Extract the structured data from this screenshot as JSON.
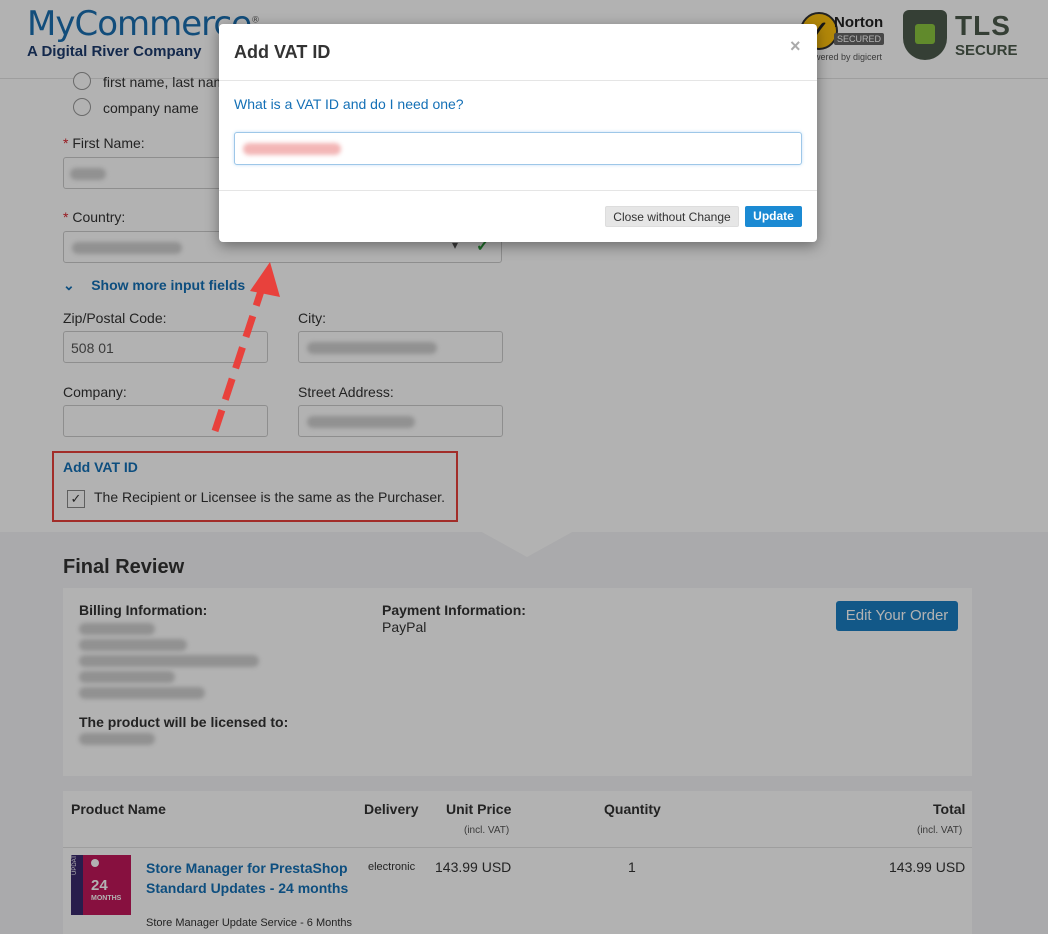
{
  "header": {
    "logo_title": "MyCommerce",
    "logo_reg": "®",
    "logo_subtitle": "A Digital River Company",
    "norton_name": "Norton",
    "norton_secured": "SECURED",
    "norton_powered": "powered by digicert",
    "tls_title": "TLS",
    "tls_sub": "SECURE"
  },
  "form": {
    "radio_name_label": "first name, last name",
    "radio_company_label": "company name",
    "first_name_label": "First Name:",
    "country_label": "Country:",
    "show_more_label": "Show more input fields",
    "zip_label": "Zip/Postal Code:",
    "zip_value": "508 01",
    "city_label": "City:",
    "company_label": "Company:",
    "street_label": "Street Address:",
    "add_vat_label": "Add VAT ID",
    "recipient_label": "The Recipient or Licensee is the same as the Purchaser.",
    "recipient_checked": true,
    "required_mark": "*"
  },
  "review": {
    "title": "Final Review",
    "billing_heading": "Billing Information:",
    "payment_heading": "Payment Information:",
    "payment_value": "PayPal",
    "edit_button": "Edit Your Order",
    "licensed_heading": "The product will be licensed to:"
  },
  "table": {
    "headers": {
      "product": "Product Name",
      "delivery": "Delivery",
      "unit_price": "Unit Price",
      "unit_price_sub": "(incl. VAT)",
      "quantity": "Quantity",
      "total": "Total",
      "total_sub": "(incl. VAT)"
    },
    "rows": [
      {
        "product_name": "Store Manager for PrestaShop Standard Updates - 24 months",
        "product_sub": "Store Manager Update Service - 6 Months",
        "delivery": "electronic",
        "unit_price": "143.99 USD",
        "quantity": "1",
        "total": "143.99 USD",
        "thumb_number": "24",
        "thumb_unit": "MONTHS",
        "thumb_side": "UPDATE"
      }
    ]
  },
  "modal": {
    "title": "Add VAT ID",
    "close_symbol": "×",
    "help_link": "What is a VAT ID and do I need one?",
    "close_button": "Close without Change",
    "update_button": "Update"
  },
  "colors": {
    "accent": "#1470b6",
    "highlight_red": "#e8413c",
    "button_blue": "#1b8ad3"
  }
}
